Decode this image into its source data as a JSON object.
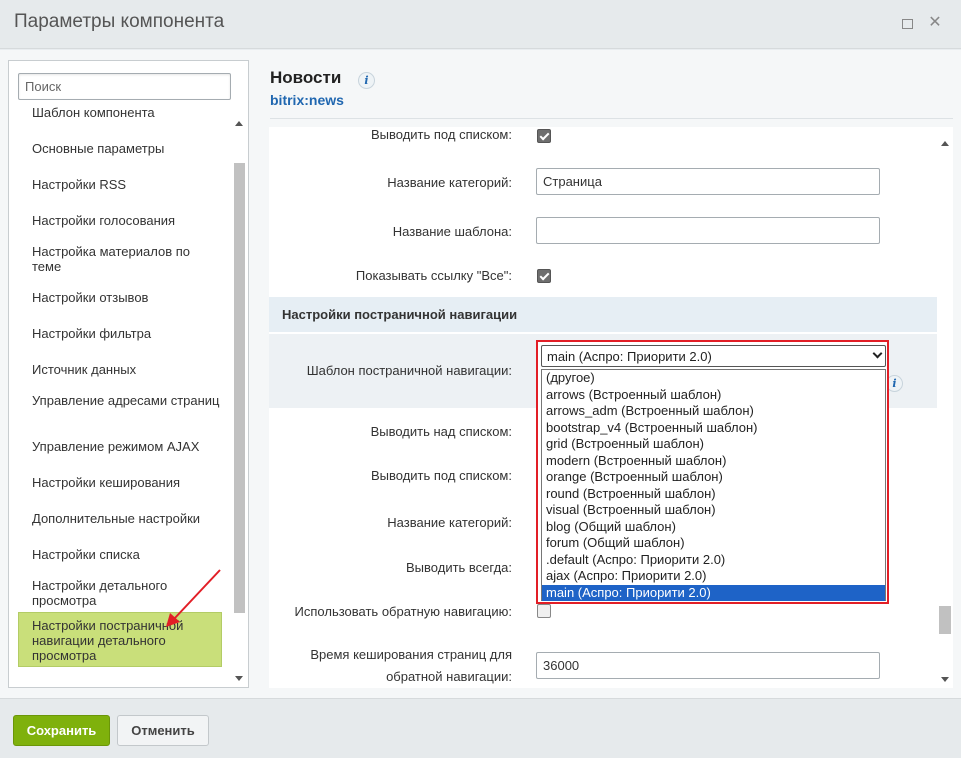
{
  "window": {
    "title": "Параметры компонента"
  },
  "component": {
    "title": "Новости",
    "code": "bitrix:news"
  },
  "sidebar": {
    "search_placeholder": "Поиск",
    "items": [
      {
        "label": "Шаблон компонента"
      },
      {
        "label": "Основные параметры"
      },
      {
        "label": "Настройки RSS"
      },
      {
        "label": "Настройки голосования"
      },
      {
        "label": "Настройка материалов по теме"
      },
      {
        "label": "Настройки отзывов"
      },
      {
        "label": "Настройки фильтра"
      },
      {
        "label": "Источник данных"
      },
      {
        "label": "Управление адресами страниц"
      },
      {
        "label": "Управление режимом AJAX"
      },
      {
        "label": "Настройки кеширования"
      },
      {
        "label": "Дополнительные настройки"
      },
      {
        "label": "Настройки списка"
      },
      {
        "label": "Настройки детального просмотра"
      },
      {
        "label": "Настройки постраничной навигации детального просмотра"
      }
    ]
  },
  "form": {
    "row_show_below_top": "Выводить под списком:",
    "category_name_label": "Название категорий:",
    "category_name_value": "Страница",
    "template_name_label": "Название шаблона:",
    "template_name_value": "",
    "show_all_link_label": "Показывать ссылку \"Все\":",
    "section_title": "Настройки постраничной навигации",
    "pager_template_label": "Шаблон постраничной навигации:",
    "show_above_label": "Выводить над списком:",
    "show_below_label": "Выводить под списком:",
    "category_name_label_2": "Название категорий:",
    "show_always_label": "Выводить всегда:",
    "reverse_nav_label": "Использовать обратную навигацию:",
    "cache_time_label_1": "Время кеширования страниц для",
    "cache_time_label_2": "обратной навигации:",
    "cache_time_value": "36000"
  },
  "dropdown": {
    "selected": "main (Аспро: Приорити 2.0)",
    "options": [
      "(другое)",
      "arrows (Встроенный шаблон)",
      "arrows_adm (Встроенный шаблон)",
      "bootstrap_v4 (Встроенный шаблон)",
      "grid (Встроенный шаблон)",
      "modern (Встроенный шаблон)",
      "orange (Встроенный шаблон)",
      "round (Встроенный шаблон)",
      "visual (Встроенный шаблон)",
      "blog (Общий шаблон)",
      "forum (Общий шаблон)",
      ".default (Аспро: Приорити 2.0)",
      "ajax (Аспро: Приорити 2.0)",
      "main (Аспро: Приорити 2.0)"
    ]
  },
  "footer": {
    "save_label": "Сохранить",
    "cancel_label": "Отменить"
  },
  "colors": {
    "save_button": "#7fb10c",
    "highlight_border": "#e21e26",
    "active_item": "#c9df7a",
    "link": "#2067b0"
  }
}
